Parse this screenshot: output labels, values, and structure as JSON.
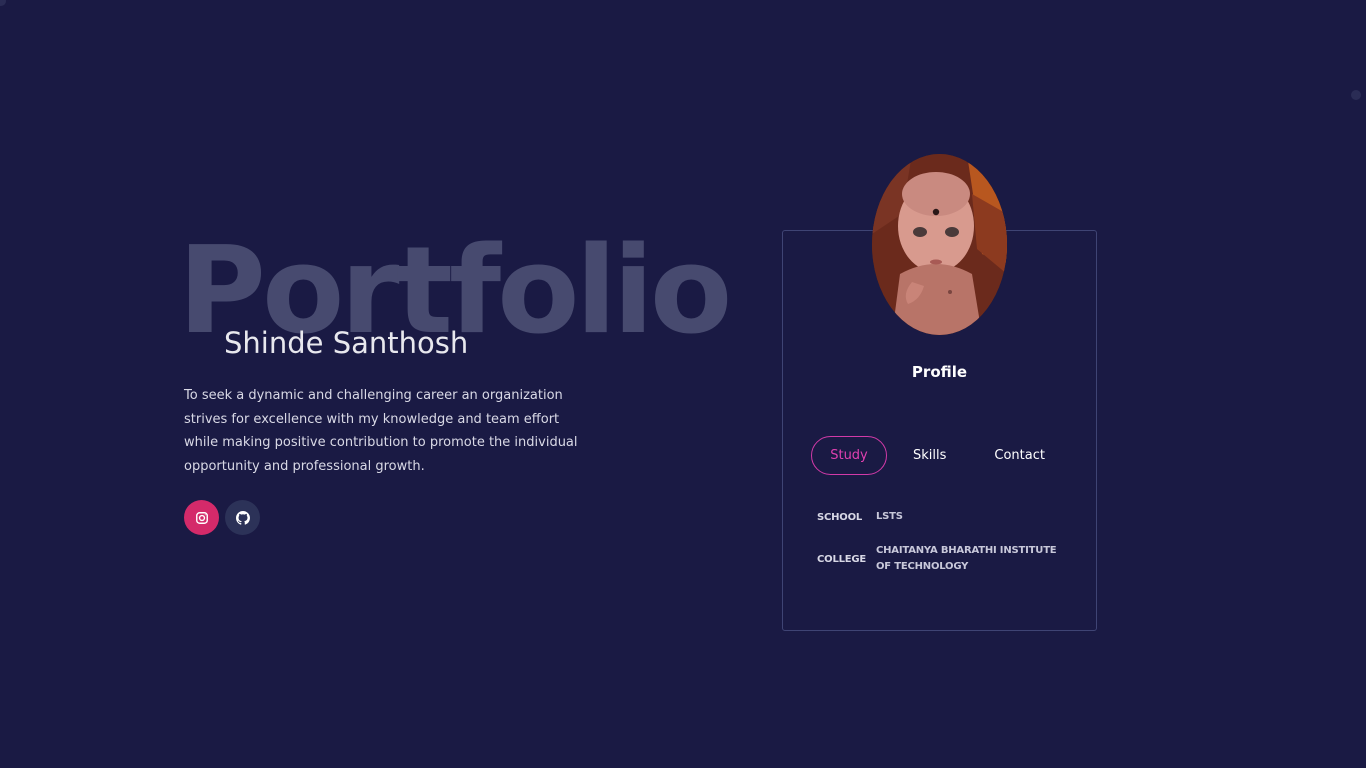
{
  "hero": {
    "background_word": "Portfolio",
    "name": "Shinde Santhosh",
    "bio": "To seek a dynamic and challenging career an organization strives for excellence with my knowledge and team effort while making positive contribution to promote the individual opportunity and professional growth."
  },
  "socials": [
    {
      "icon": "instagram-icon",
      "color": "#d42a6a"
    },
    {
      "icon": "github-icon",
      "color": "#2c3258"
    }
  ],
  "profile_card": {
    "title": "Profile",
    "tabs": [
      {
        "label": "Study",
        "active": true
      },
      {
        "label": "Skills",
        "active": false
      },
      {
        "label": "Contact",
        "active": false
      }
    ],
    "study": [
      {
        "key": "SCHOOL",
        "value": "LSTS"
      },
      {
        "key": "COLLEGE",
        "value": "CHAITANYA BHARATHI INSTITUTE OF TECHNOLOGY"
      }
    ]
  },
  "colors": {
    "background": "#1a1a44",
    "accent_pink": "#d23aa8",
    "instagram": "#d42a6a",
    "github": "#2c3258",
    "card_border": "#3f4474"
  }
}
